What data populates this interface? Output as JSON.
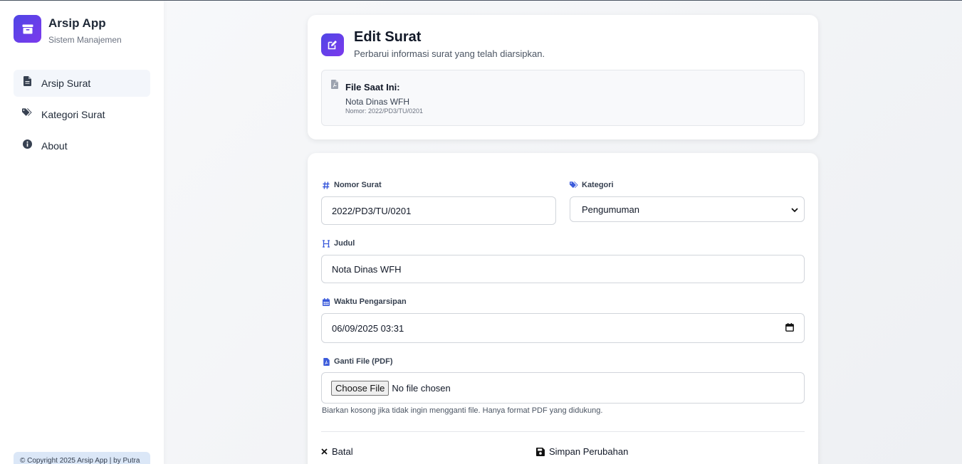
{
  "app": {
    "title": "Arsip App",
    "subtitle": "Sistem Manajemen",
    "icon": "archive-icon"
  },
  "sidebar": {
    "items": [
      {
        "label": "Arsip Surat",
        "icon": "file-icon",
        "active": true
      },
      {
        "label": "Kategori Surat",
        "icon": "tags-icon",
        "active": false
      },
      {
        "label": "About",
        "icon": "info-icon",
        "active": false
      }
    ],
    "copyright": "© Copyright 2025 Arsip App | by Putra"
  },
  "header": {
    "title": "Edit Surat",
    "subtitle": "Perbarui informasi surat yang telah diarsipkan.",
    "icon": "edit-icon"
  },
  "current_file": {
    "label": "File Saat Ini:",
    "name": "Nota Dinas WFH",
    "number": "Nomor: 2022/PD3/TU/0201"
  },
  "form": {
    "nomor": {
      "label": "Nomor Surat",
      "value": "2022/PD3/TU/0201"
    },
    "kategori": {
      "label": "Kategori",
      "value": "Pengumuman"
    },
    "judul": {
      "label": "Judul",
      "value": "Nota Dinas WFH"
    },
    "waktu": {
      "label": "Waktu Pengarsipan",
      "value": "06/09/2025 03:31"
    },
    "file": {
      "label": "Ganti File (PDF)",
      "button": "Choose File",
      "status": "No file chosen"
    },
    "hint": "Biarkan kosong jika tidak ingin mengganti file. Hanya format PDF yang didukung.",
    "cancel_label": "Batal",
    "save_label": "Simpan Perubahan"
  },
  "colors": {
    "accent": "#4f46e5",
    "accent2": "#7c3aed",
    "label_icon": "#3b5bdb",
    "copyright_bg": "#dbe7f7"
  }
}
